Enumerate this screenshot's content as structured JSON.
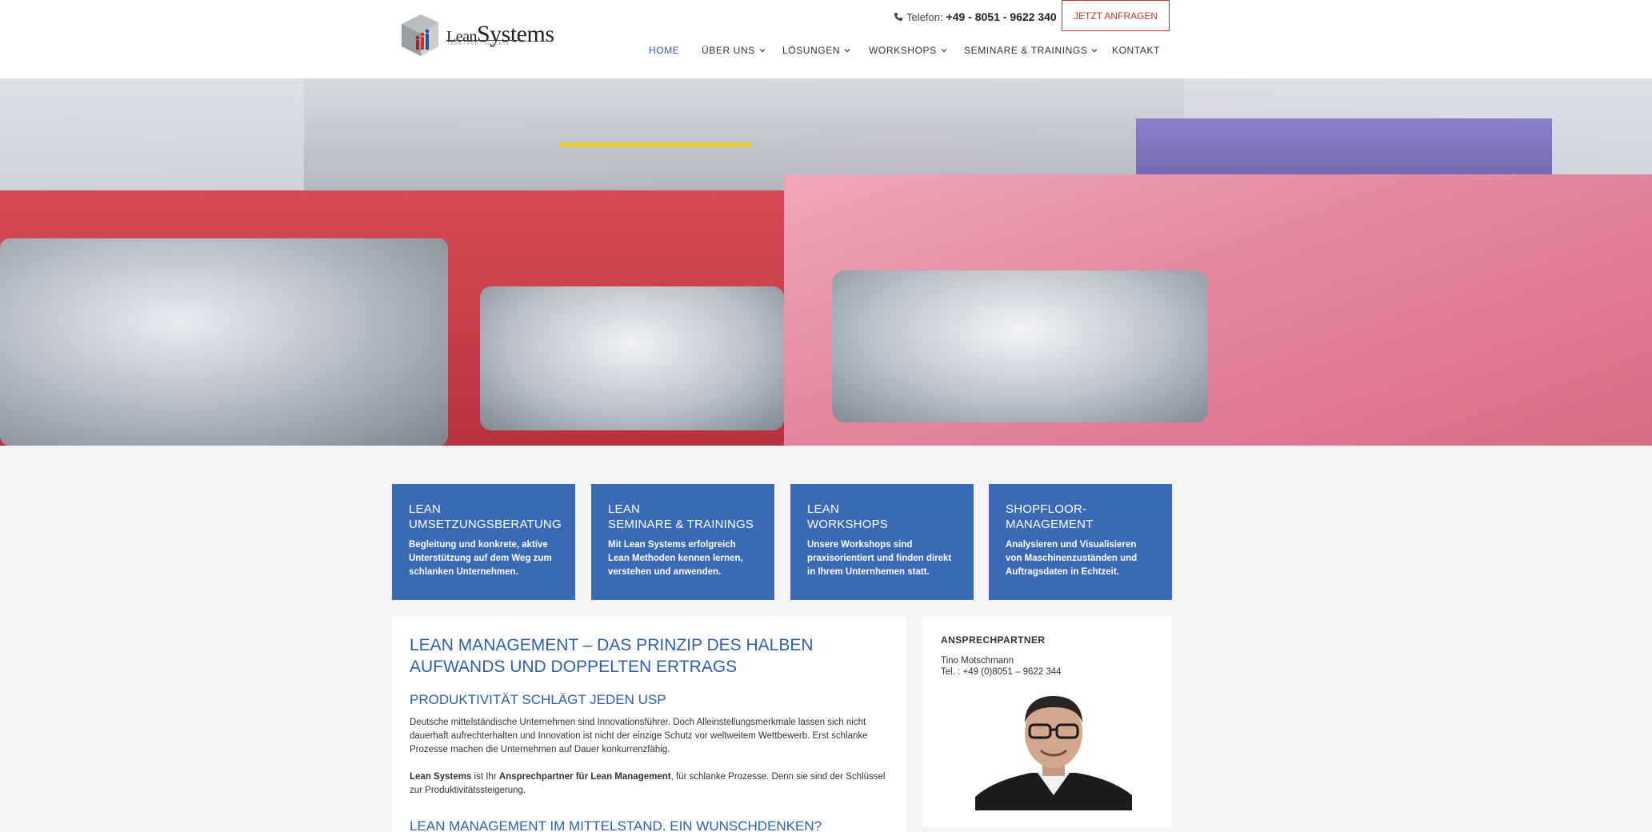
{
  "header": {
    "logo_text_a": "Lean",
    "logo_text_b": "Systems",
    "logo_tagline": "LEAN · FOR · SUCCESS",
    "phone_label": "Telefon:",
    "phone_number": "+49 - 8051 - 9622 340",
    "cta_label": "JETZT ANFRAGEN",
    "nav": [
      {
        "label": "HOME",
        "active": true
      },
      {
        "label": "ÜBER UNS",
        "dropdown": true
      },
      {
        "label": "LÖSUNGEN",
        "dropdown": true
      },
      {
        "label": "WORKSHOPS",
        "dropdown": true
      },
      {
        "label": "SEMINARE & TRAININGS",
        "dropdown": true
      },
      {
        "label": "KONTAKT"
      }
    ]
  },
  "services": [
    {
      "title_1": "LEAN",
      "title_2": "UMSETZUNGSBERATUNG",
      "text": "Begleitung und konkrete, aktive Unterstützung auf dem Weg zum schlanken Unternehmen."
    },
    {
      "title_1": "LEAN",
      "title_2": "SEMINARE & TRAININGS",
      "text": "Mit Lean Systems erfolgreich Lean Methoden kennen lernen, verstehen und anwenden."
    },
    {
      "title_1": "LEAN",
      "title_2": "WORKSHOPS",
      "text": "Unsere Workshops sind praxisorientiert und finden direkt in Ihrem Unternhemen statt."
    },
    {
      "title_1": "SHOPFLOOR-",
      "title_2": "MANAGEMENT",
      "text": "Analysieren und Visualisieren von Maschinenzuständen und Auftragsdaten in Echtzeit."
    }
  ],
  "main": {
    "headline": "LEAN MANAGEMENT – DAS PRINZIP DES HALBEN AUFWANDS UND DOPPELTEN ERTRAGS",
    "sub1": "PRODUKTIVITÄT SCHLÄGT JEDEN USP",
    "para1": "Deutsche mittelständische Unternehmen sind Innovationsführer. Doch Alleinstellungsmerkmale lassen sich nicht dauerhaft aufrechterhalten und Innovation ist nicht der einzige Schutz vor weltweitem Wettbewerb. Erst schlanke Prozesse machen die Unternehmen auf Dauer konkurrenzfähig.",
    "para2_b1": "Lean Systems",
    "para2_t1": " ist Ihr ",
    "para2_b2": "Ansprechpartner für Lean Management",
    "para2_t2": ", für schlanke Prozesse. Denn sie sind der Schlüssel zur Produktivitätssteigerung.",
    "sub2": "LEAN MANAGEMENT IM MITTELSTAND. EIN WUNSCHDENKEN?"
  },
  "sidebar": {
    "title": "ANSPRECHPARTNER",
    "name": "Tino Motschmann",
    "tel": "Tel. : +49 (0)8051 – 9622 344"
  },
  "colors": {
    "accent_blue": "#3a6ab3",
    "link_blue": "#2f5fa7",
    "cta_red": "#c0392b"
  }
}
